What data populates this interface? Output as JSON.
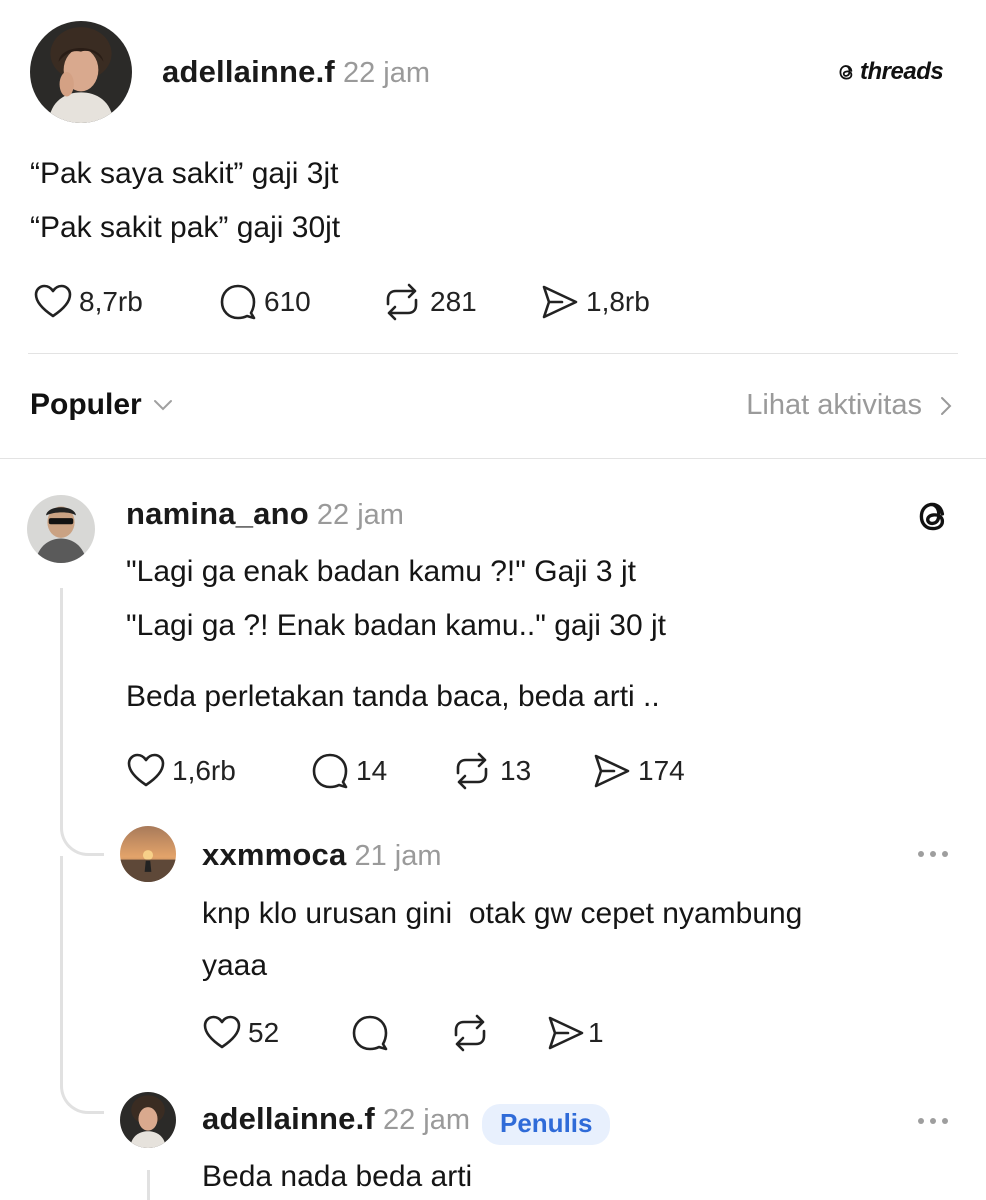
{
  "post": {
    "username": "adellainne.f",
    "time": "22 jam",
    "brand_label": "threads",
    "lines": [
      "“Pak saya sakit” gaji 3jt",
      "“Pak sakit pak” gaji 30jt"
    ],
    "likes": "8,7rb",
    "replies": "610",
    "reposts": "281",
    "shares": "1,8rb"
  },
  "sort": {
    "label": "Populer",
    "activity_link": "Lihat aktivitas"
  },
  "comments": [
    {
      "username": "namina_ano",
      "time": "22 jam",
      "lines": [
        "\"Lagi ga enak badan kamu ?!\" Gaji 3 jt",
        "\"Lagi ga ?! Enak badan kamu..\" gaji 30 jt",
        "Beda perletakan tanda baca, beda arti .."
      ],
      "likes": "1,6rb",
      "replies": "14",
      "reposts": "13",
      "shares": "174"
    },
    {
      "username": "xxmmoca",
      "time": "21 jam",
      "lines": [
        "knp klo urusan gini  otak gw cepet nyambung",
        "yaaa"
      ],
      "likes": "52",
      "shares": "1"
    },
    {
      "username": "adellainne.f",
      "time": "22 jam",
      "badge": "Penulis",
      "lines": [
        "Beda nada beda arti"
      ]
    }
  ],
  "icons": {
    "like": "heart-icon",
    "reply": "speech-bubble-icon",
    "repost": "repost-arrows-icon",
    "share": "send-icon",
    "more": "more-dots-icon",
    "brand": "threads-logo-icon",
    "chevron_down": "chevron-down-icon",
    "chevron_right": "chevron-right-icon"
  },
  "colors": {
    "text": "#111111",
    "muted": "#9a9a9a",
    "badge_bg": "#e8f0fd",
    "badge_text": "#2f6bd8"
  }
}
